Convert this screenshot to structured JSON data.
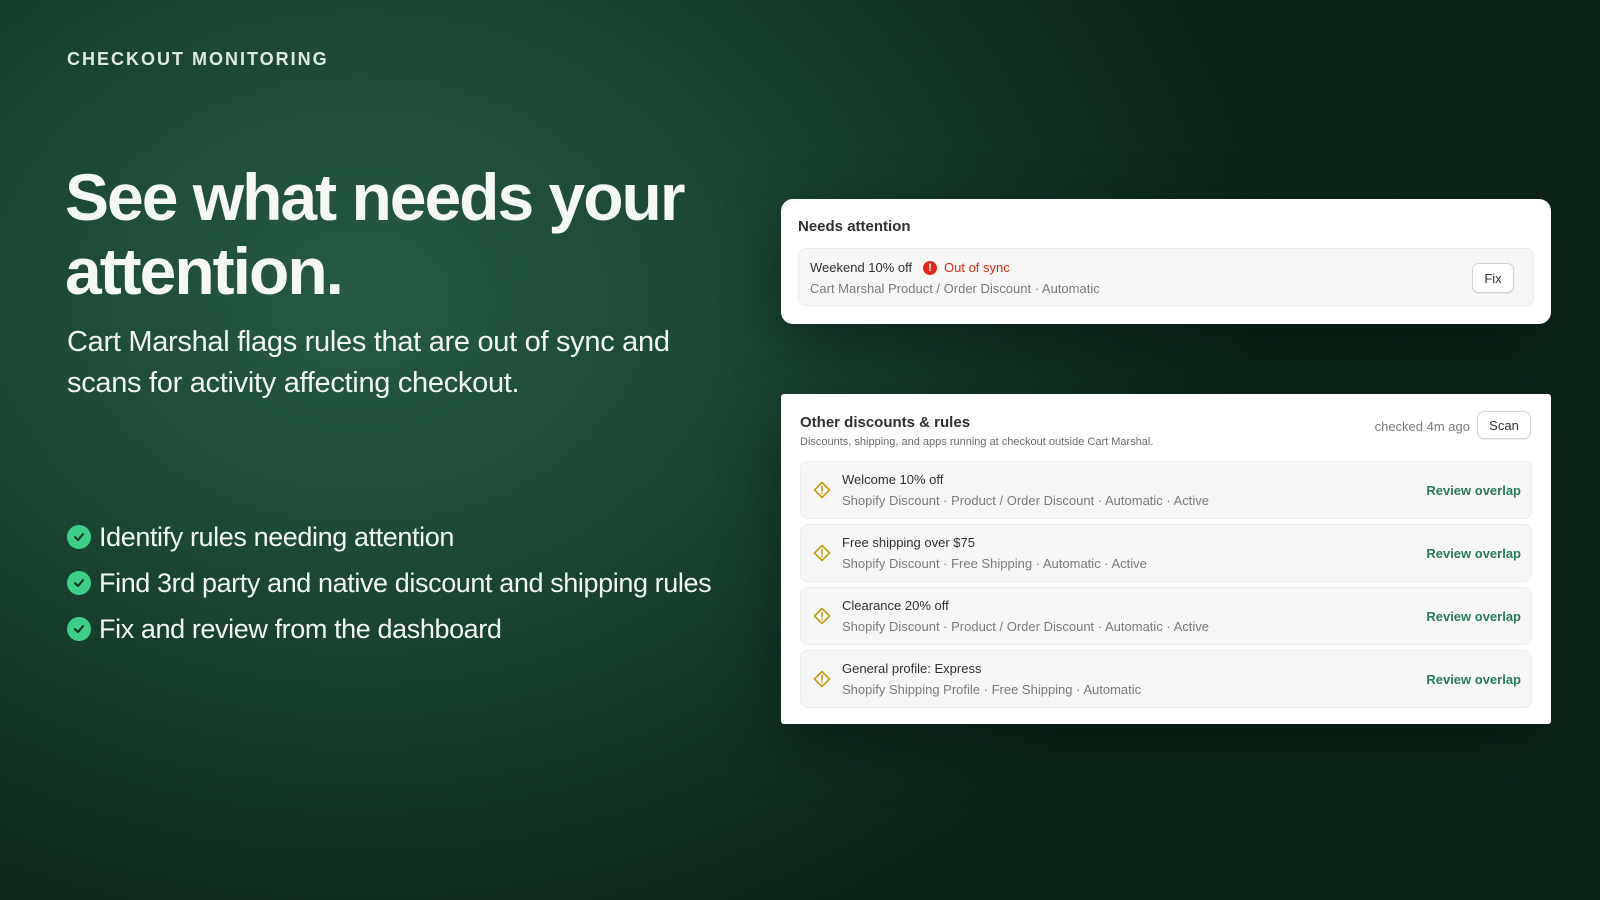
{
  "eyebrow": "CHECKOUT MONITORING",
  "headline": "See what needs your attention.",
  "subhead": "Cart Marshal flags rules that are out of sync and scans for activity affecting checkout.",
  "bullets": [
    "Identify rules needing attention",
    "Find 3rd party and native discount and shipping rules",
    "Fix and review from the dashboard"
  ],
  "needs_attention": {
    "title": "Needs attention",
    "item": {
      "name": "Weekend 10% off",
      "status": "Out of sync",
      "meta": "Cart Marshal Product / Order Discount  · Automatic",
      "action_label": "Fix"
    }
  },
  "other_rules": {
    "title": "Other discounts & rules",
    "description": "Discounts, shipping, and apps running at checkout outside Cart Marshal.",
    "checked": "checked 4m ago",
    "scan_label": "Scan",
    "items": [
      {
        "name": "Welcome 10% off",
        "meta": "Shopify Discount  · Product / Order Discount  · Automatic  · Active",
        "action": "Review overlap"
      },
      {
        "name": "Free shipping over $75",
        "meta": "Shopify Discount  · Free Shipping  · Automatic  · Active",
        "action": "Review overlap"
      },
      {
        "name": "Clearance 20% off",
        "meta": "Shopify Discount  · Product / Order Discount  · Automatic  · Active",
        "action": "Review overlap"
      },
      {
        "name": "General profile: Express",
        "meta": "Shopify Shipping Profile  · Free Shipping  · Automatic",
        "action": "Review overlap"
      }
    ]
  },
  "colors": {
    "accent_green": "#3fce8a",
    "review_link": "#2a7a57",
    "error_red": "#d72c0d",
    "warning_amber": "#c99a12"
  }
}
